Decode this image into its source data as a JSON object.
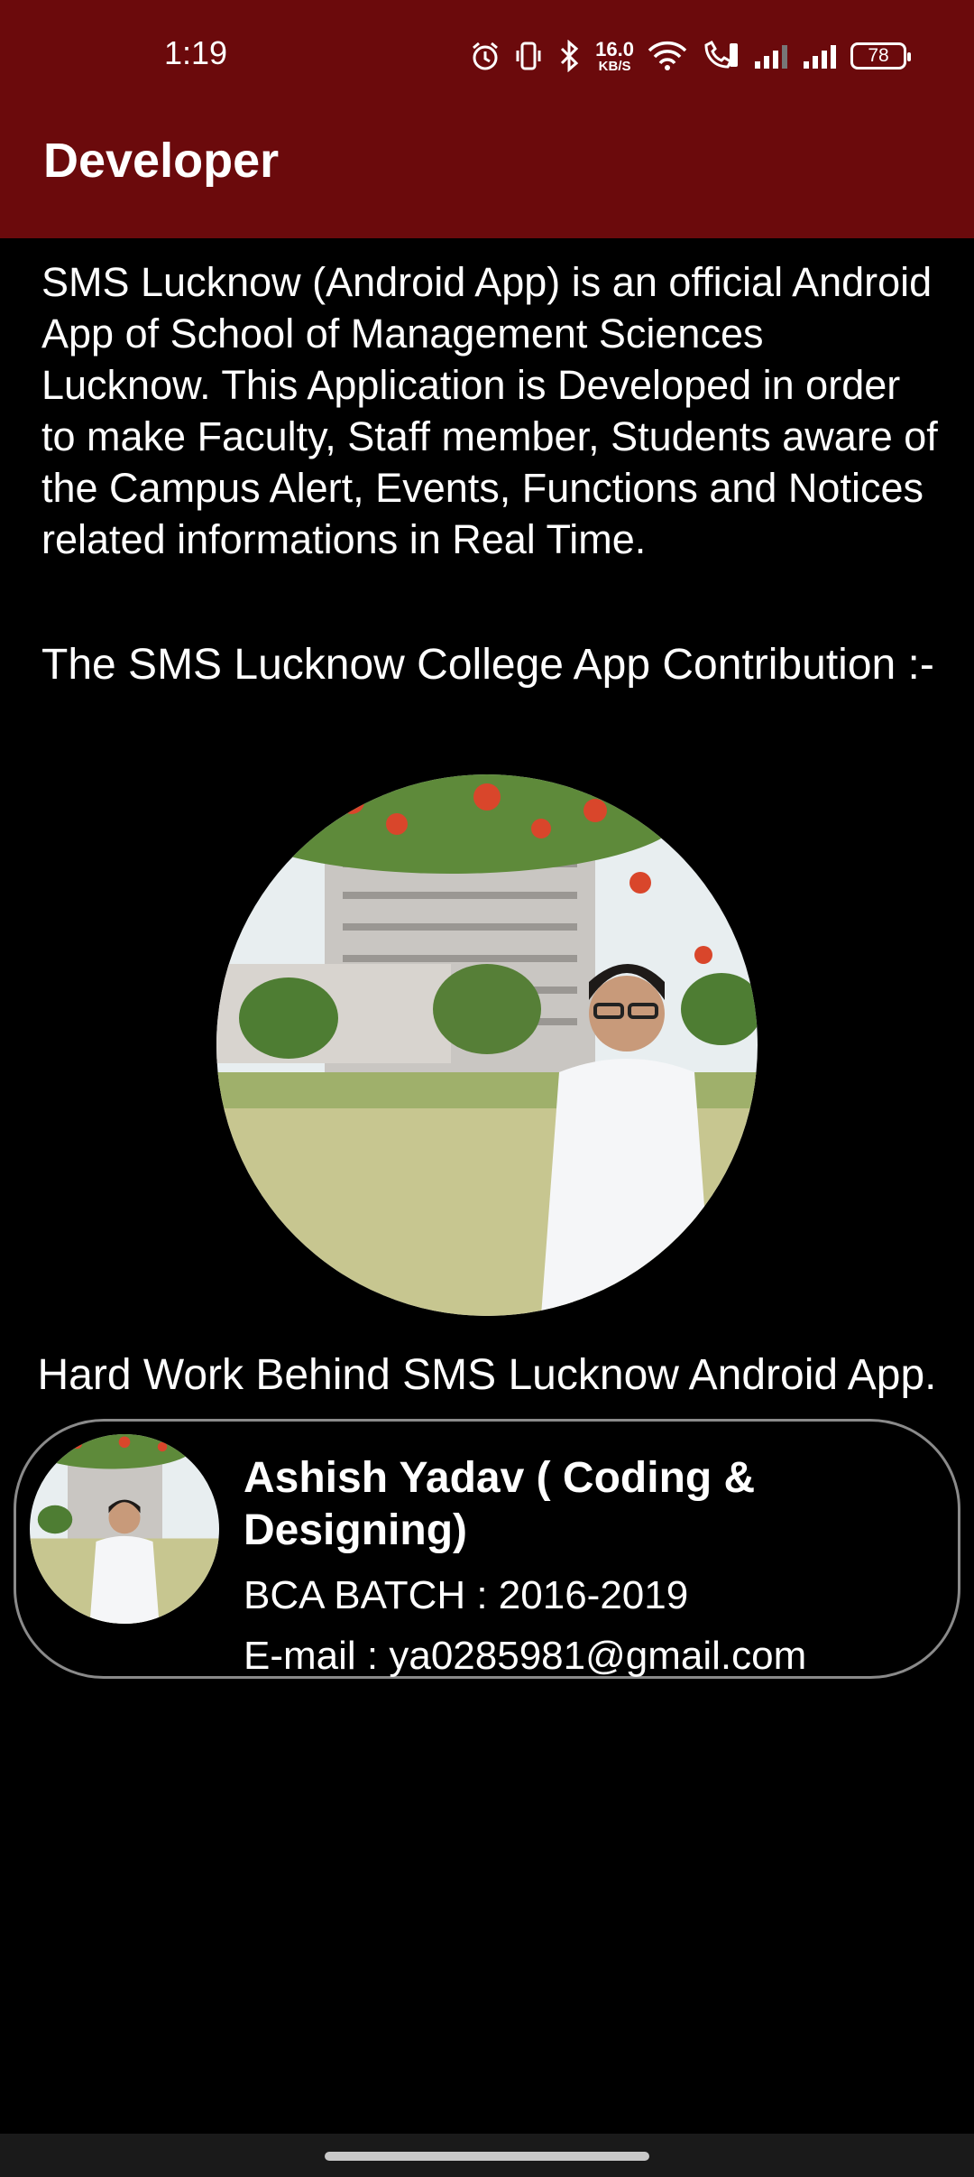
{
  "status_bar": {
    "time": "1:19",
    "net_speed_value": "16.0",
    "net_speed_unit": "KB/S",
    "battery": "78",
    "icons": [
      "alarm-icon",
      "vibrate-icon",
      "bluetooth-icon",
      "wifi-icon",
      "volte-call-icon",
      "signal-icon",
      "signal-icon"
    ]
  },
  "app_bar": {
    "title": "Developer"
  },
  "main": {
    "description": "SMS Lucknow (Android App) is an official Android App of School of Management Sciences Lucknow. This Application is Developed in order to make Faculty, Staff member, Students aware of the Campus Alert, Events, Functions and Notices related informations in Real Time.",
    "contribution_heading": "The SMS Lucknow College App Contribution :-",
    "hard_work_caption": "Hard Work Behind SMS Lucknow Android App."
  },
  "developer_card": {
    "name": "Ashish Yadav ( Coding & Designing)",
    "batch": "BCA BATCH : 2016-2019",
    "email": "E-mail : ya0285981@gmail.com"
  },
  "colors": {
    "primary": "#6b0a0c",
    "background": "#000000",
    "text": "#ffffff"
  }
}
